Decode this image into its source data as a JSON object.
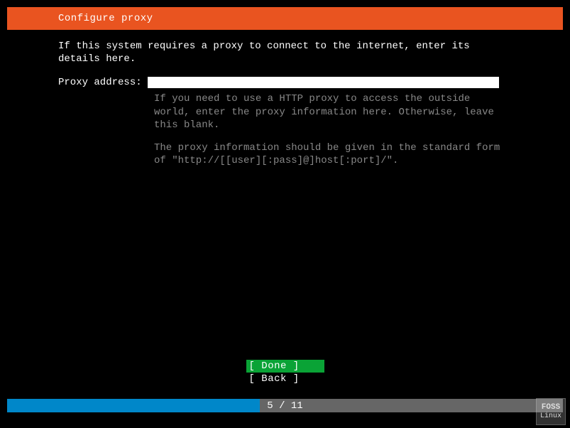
{
  "header": {
    "title": "Configure proxy"
  },
  "intro": "If this system requires a proxy to connect to the internet, enter its details here.",
  "field": {
    "label": "Proxy address: ",
    "value": "",
    "hint1": "If you need to use a HTTP proxy to access the outside world, enter the proxy information here. Otherwise, leave this blank.",
    "hint2": "The proxy information should be given in the standard form of \"http://[[user][:pass]@]host[:port]/\"."
  },
  "buttons": {
    "done": "[ Done       ]",
    "back": "[ Back       ]"
  },
  "progress": {
    "current": 5,
    "total": 11,
    "text": "5 / 11",
    "percent": 45.45
  },
  "watermark": {
    "line1": "FOSS",
    "line2": "Linux"
  }
}
